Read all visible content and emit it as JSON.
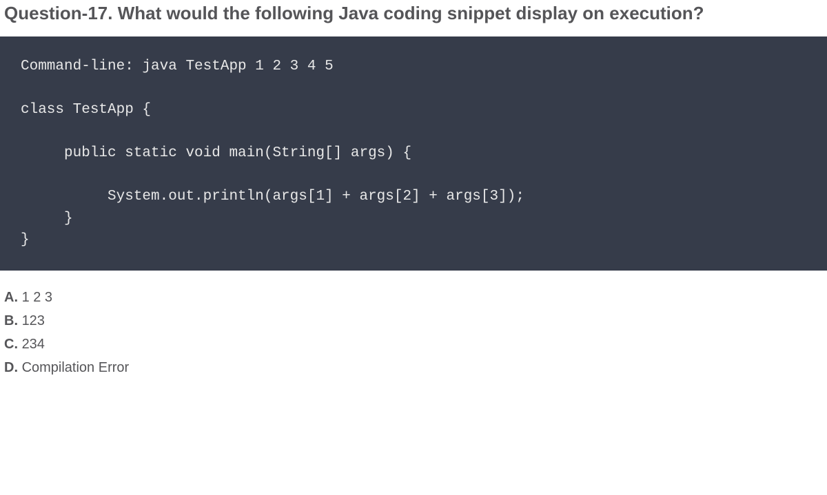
{
  "question_title": "Question-17. What would the following Java coding snippet display on execution?",
  "code": "Command-line: java TestApp 1 2 3 4 5\n\nclass TestApp {\n\n     public static void main(String[] args) {\n\n          System.out.println(args[1] + args[2] + args[3]);\n     }\n}",
  "options": [
    {
      "label": "A.",
      "text": "1 2 3"
    },
    {
      "label": "B.",
      "text": "123"
    },
    {
      "label": "C.",
      "text": "234"
    },
    {
      "label": "D.",
      "text": "Compilation Error"
    }
  ]
}
